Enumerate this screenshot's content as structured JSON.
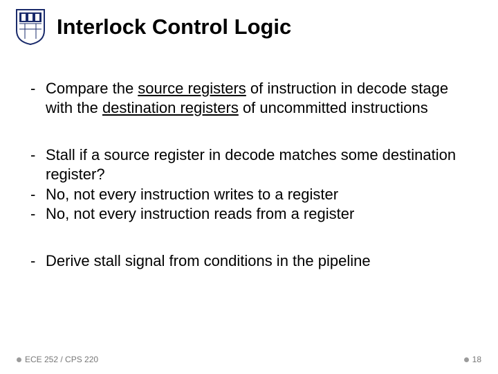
{
  "title": "Interlock Control Logic",
  "bullets": {
    "g1": {
      "b1_pre": "Compare the ",
      "b1_u1": "source registers",
      "b1_mid": " of instruction in decode stage with the ",
      "b1_u2": "destination registers",
      "b1_post": " of uncommitted instructions"
    },
    "g2": {
      "b1": "Stall if a source register in decode matches some destination register?",
      "b2": "No, not every instruction writes to a register",
      "b3": "No, not every instruction reads from a register"
    },
    "g3": {
      "b1": "Derive stall signal from conditions in the pipeline"
    }
  },
  "footer": {
    "course": "ECE 252 / CPS 220",
    "page": "18"
  }
}
